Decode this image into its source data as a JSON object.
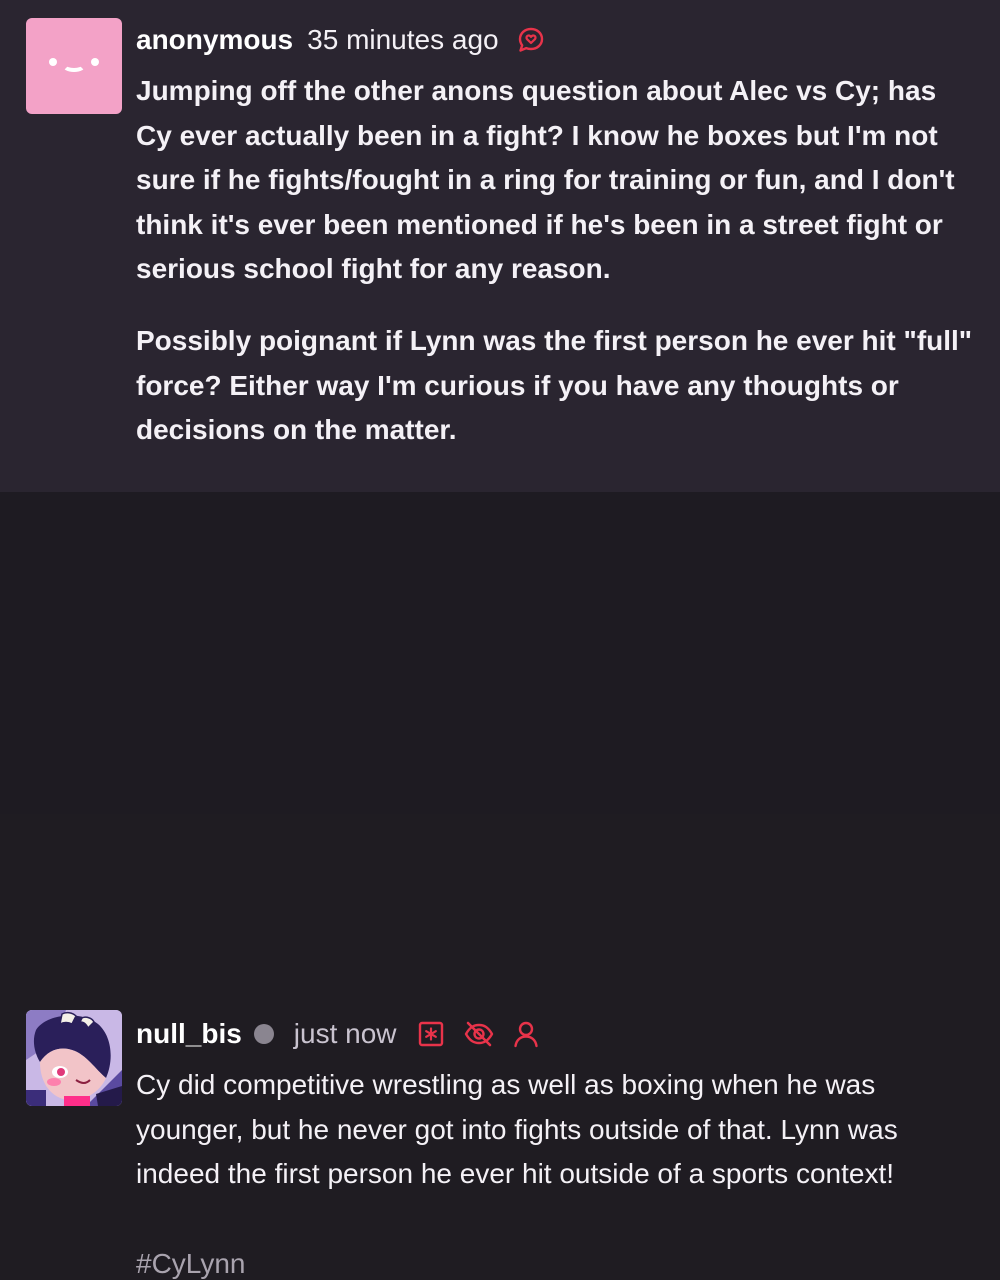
{
  "ask": {
    "username": "anonymous",
    "timestamp": "35 minutes ago",
    "icon": "ask-bubble-heart-icon",
    "paragraphs": [
      "Jumping off the other anons question about Alec vs Cy; has Cy ever actually been in a fight? I know he boxes but I'm not sure if he fights/fought in a ring for training or fun, and I don't think it's ever been mentioned if he's been in a street fight or serious school fight for any reason.",
      "Possibly poignant if Lynn was the first person he ever hit \"full\" force? Either way I'm curious if you have any thoughts or decisions on the matter."
    ]
  },
  "answer": {
    "username": "null_bis",
    "timestamp": "just now",
    "icons": [
      "asterisk-box-icon",
      "eye-slash-icon",
      "user-icon"
    ],
    "paragraph": "Cy did competitive wrestling as well as boxing when he was younger, but he never got into fights outside of that. Lynn was indeed the first person he ever hit outside of a sports context!",
    "tag": "#CyLynn"
  },
  "colors": {
    "accent": "#e8334a",
    "ask_bg": "#2a2530",
    "answer_bg": "#1e1b22",
    "anon_avatar": "#f3a2c7"
  }
}
